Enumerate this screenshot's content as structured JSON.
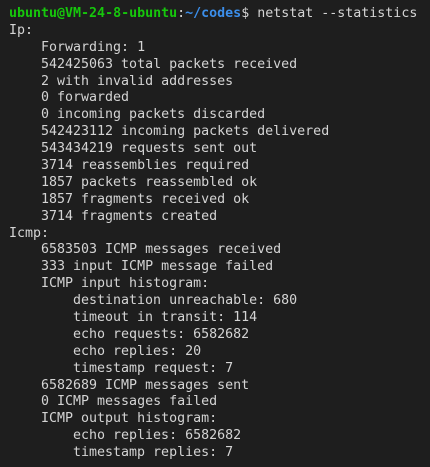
{
  "prompt": {
    "user_host": "ubuntu@VM-24-8-ubuntu",
    "separator": ":",
    "path": "~/codes",
    "symbol": "$",
    "command": "netstat --statistics"
  },
  "ip": {
    "header": "Ip:",
    "lines": [
      "Forwarding: 1",
      "542425063 total packets received",
      "2 with invalid addresses",
      "0 forwarded",
      "0 incoming packets discarded",
      "542423112 incoming packets delivered",
      "543434219 requests sent out",
      "3714 reassemblies required",
      "1857 packets reassembled ok",
      "1857 fragments received ok",
      "3714 fragments created"
    ]
  },
  "icmp": {
    "header": "Icmp:",
    "messages_received": "6583503 ICMP messages received",
    "input_failed": "333 input ICMP message failed",
    "input_histogram_title": "ICMP input histogram:",
    "input_histogram": [
      "destination unreachable: 680",
      "timeout in transit: 114",
      "echo requests: 6582682",
      "echo replies: 20",
      "timestamp request: 7"
    ],
    "messages_sent": "6582689 ICMP messages sent",
    "messages_failed": "0 ICMP messages failed",
    "output_histogram_title": "ICMP output histogram:",
    "output_histogram": [
      "echo replies: 6582682",
      "timestamp replies: 7"
    ]
  },
  "colors": {
    "background": "#1e1e1e",
    "text": "#d4d4d4",
    "user_host": "#16c60c",
    "path": "#3b8eea"
  }
}
